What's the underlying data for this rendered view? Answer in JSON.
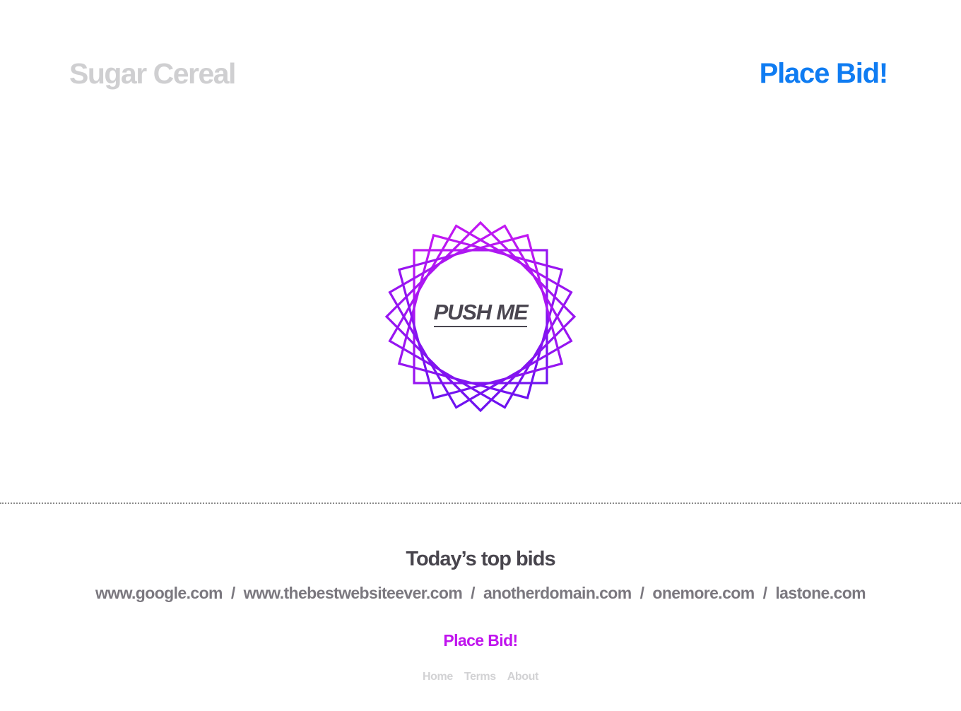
{
  "header": {
    "brand": "Sugar Cereal",
    "cta_label": "Place Bid!"
  },
  "hero": {
    "button_label": "PUSH ME",
    "ring_gradient": [
      "#c218f2",
      "#6d12f0"
    ]
  },
  "bids": {
    "title": "Today’s top bids",
    "separator": "/",
    "items": [
      "www.google.com",
      "www.thebestwebsiteever.com",
      "anotherdomain.com",
      "onemore.com",
      "lastone.com"
    ]
  },
  "footer": {
    "cta_label": "Place Bid!",
    "nav": [
      "Home",
      "Terms",
      "About"
    ]
  },
  "colors": {
    "brand": "#cfcfd1",
    "header_cta": "#0f7cf2",
    "footer_cta": "#c014ee",
    "body_text": "#48454d",
    "muted_link": "#7b787f",
    "footer_link": "#d2d2d4"
  }
}
